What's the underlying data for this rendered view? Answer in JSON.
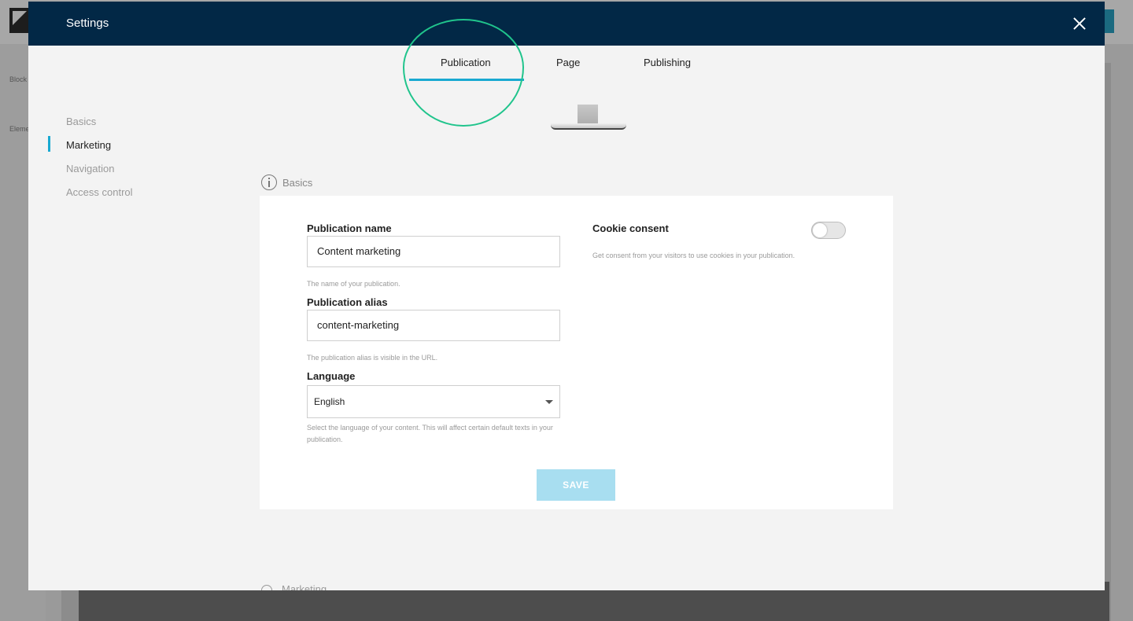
{
  "background": {
    "left_panel": {
      "blocks_label": "Block",
      "elements_label": "Eleme"
    }
  },
  "modal": {
    "title": "Settings",
    "close_icon": "close-icon"
  },
  "tabs": [
    {
      "label": "Publication",
      "active": true
    },
    {
      "label": "Page",
      "active": false
    },
    {
      "label": "Publishing",
      "active": false
    }
  ],
  "sidebar": {
    "items": [
      {
        "label": "Basics",
        "active": false
      },
      {
        "label": "Marketing",
        "active": true
      },
      {
        "label": "Navigation",
        "active": false
      },
      {
        "label": "Access control",
        "active": false
      }
    ]
  },
  "section": {
    "title": "Basics",
    "icon": "info-icon"
  },
  "form": {
    "publication_name": {
      "label": "Publication name",
      "value": "Content marketing",
      "hint": "The name of your publication."
    },
    "publication_alias": {
      "label": "Publication alias",
      "value": "content-marketing",
      "hint": "The publication alias is visible in the URL."
    },
    "language": {
      "label": "Language",
      "selected": "English",
      "hint": "Select the language of your content. This will affect certain default texts in your publication."
    },
    "cookie_consent": {
      "label": "Cookie consent",
      "hint": "Get consent from your visitors to use cookies in your publication.",
      "enabled": false
    },
    "save_label": "SAVE"
  },
  "next_section": {
    "title": "Marketing"
  },
  "colors": {
    "header_bg": "#022846",
    "accent": "#19a9d1",
    "annotation_circle": "#20c48c",
    "save_disabled": "#a8def0"
  }
}
